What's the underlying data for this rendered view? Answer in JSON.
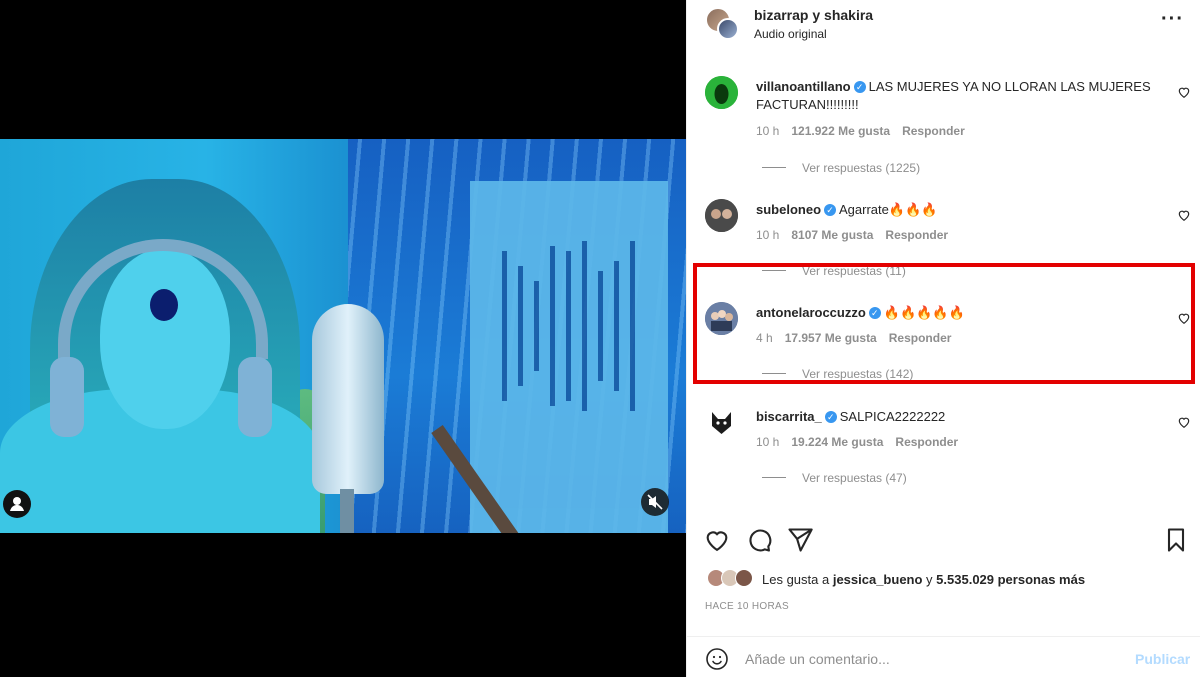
{
  "post": {
    "author": "bizarrap y shakira",
    "audio": "Audio original",
    "more_icon": "ellipsis-icon"
  },
  "media": {
    "user_badge_icon": "user-icon",
    "mute_badge_icon": "muted-speaker-icon"
  },
  "comments": [
    {
      "username": "villanoantillano",
      "verified": true,
      "text": "LAS MUJERES YA NO LLORAN LAS MUJERES FACTURAN!!!!!!!!!",
      "time": "10 h",
      "likes": "121.922 Me gusta",
      "reply_label": "Responder",
      "replies_label": "Ver respuestas (1225)",
      "avatar_color": "#1fa12a"
    },
    {
      "username": "subeloneo",
      "verified": true,
      "text": "Agarrate🔥🔥🔥",
      "time": "10 h",
      "likes": "8107 Me gusta",
      "reply_label": "Responder",
      "replies_label": "Ver respuestas (11)",
      "avatar_color": "#3a3a3a"
    },
    {
      "username": "antonelaroccuzzo",
      "verified": true,
      "text": "🔥🔥🔥🔥🔥",
      "time": "4 h",
      "likes": "17.957 Me gusta",
      "reply_label": "Responder",
      "replies_label": "Ver respuestas (142)",
      "avatar_color": "#5b6d8c"
    },
    {
      "username": "biscarrita_",
      "verified": true,
      "text": "SALPICA2222222",
      "time": "10 h",
      "likes": "19.224 Me gusta",
      "reply_label": "Responder",
      "replies_label": "Ver respuestas (47)",
      "avatar_color": "#1c1c1c"
    }
  ],
  "actions": {
    "like_icon": "heart-icon",
    "comment_icon": "speech-bubble-icon",
    "share_icon": "paper-plane-icon",
    "save_icon": "bookmark-icon"
  },
  "likes_summary": {
    "prefix": "Les gusta a ",
    "user": "jessica_bueno",
    "connector": " y ",
    "others": "5.535.029 personas más"
  },
  "time_ago": "HACE 10 HORAS",
  "add_comment": {
    "placeholder": "Añade un comentario...",
    "publish_label": "Publicar",
    "emoji_icon": "smiley-icon"
  },
  "highlight_color": "#e30000"
}
